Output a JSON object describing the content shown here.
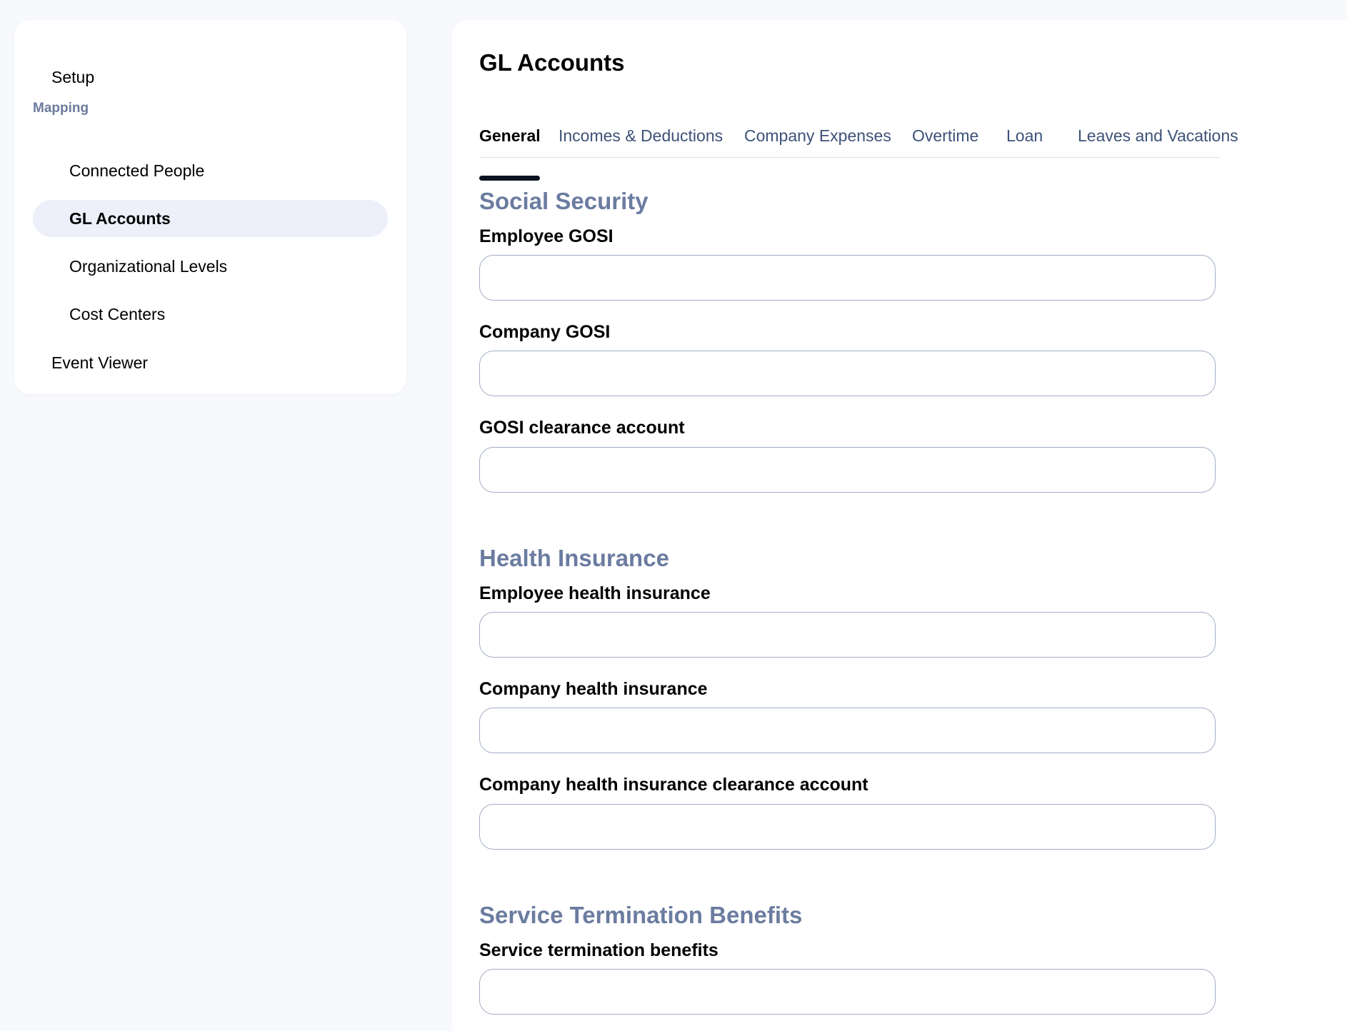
{
  "sidebar": {
    "setup": "Setup",
    "group_label": "Mapping",
    "items": [
      {
        "label": "Connected People"
      },
      {
        "label": "GL Accounts"
      },
      {
        "label": "Organizational Levels"
      },
      {
        "label": "Cost Centers"
      }
    ],
    "event_viewer": "Event Viewer",
    "active_item": "GL Accounts"
  },
  "main": {
    "title": "GL Accounts",
    "tabs": [
      {
        "label": "General"
      },
      {
        "label": "Incomes & Deductions"
      },
      {
        "label": "Company Expenses"
      },
      {
        "label": "Overtime"
      },
      {
        "label": "Loan"
      },
      {
        "label": "Leaves and Vacations"
      }
    ],
    "active_tab": "General",
    "sections": [
      {
        "heading": "Social Security",
        "fields": [
          {
            "label": "Employee GOSI",
            "value": ""
          },
          {
            "label": "Company GOSI",
            "value": ""
          },
          {
            "label": "GOSI clearance account",
            "value": ""
          }
        ]
      },
      {
        "heading": "Health Insurance",
        "fields": [
          {
            "label": "Employee health insurance",
            "value": ""
          },
          {
            "label": "Company health insurance",
            "value": ""
          },
          {
            "label": "Company health insurance clearance account",
            "value": ""
          }
        ]
      },
      {
        "heading": "Service Termination Benefits",
        "fields": [
          {
            "label": "Service termination benefits",
            "value": ""
          }
        ]
      }
    ]
  },
  "colors": {
    "page_background": "#f7f9fd",
    "section_heading": "#6b7ca0",
    "tab_text": "#3d5278",
    "active_nav_background": "#edf0fa",
    "input_border": "#a3afc4"
  }
}
